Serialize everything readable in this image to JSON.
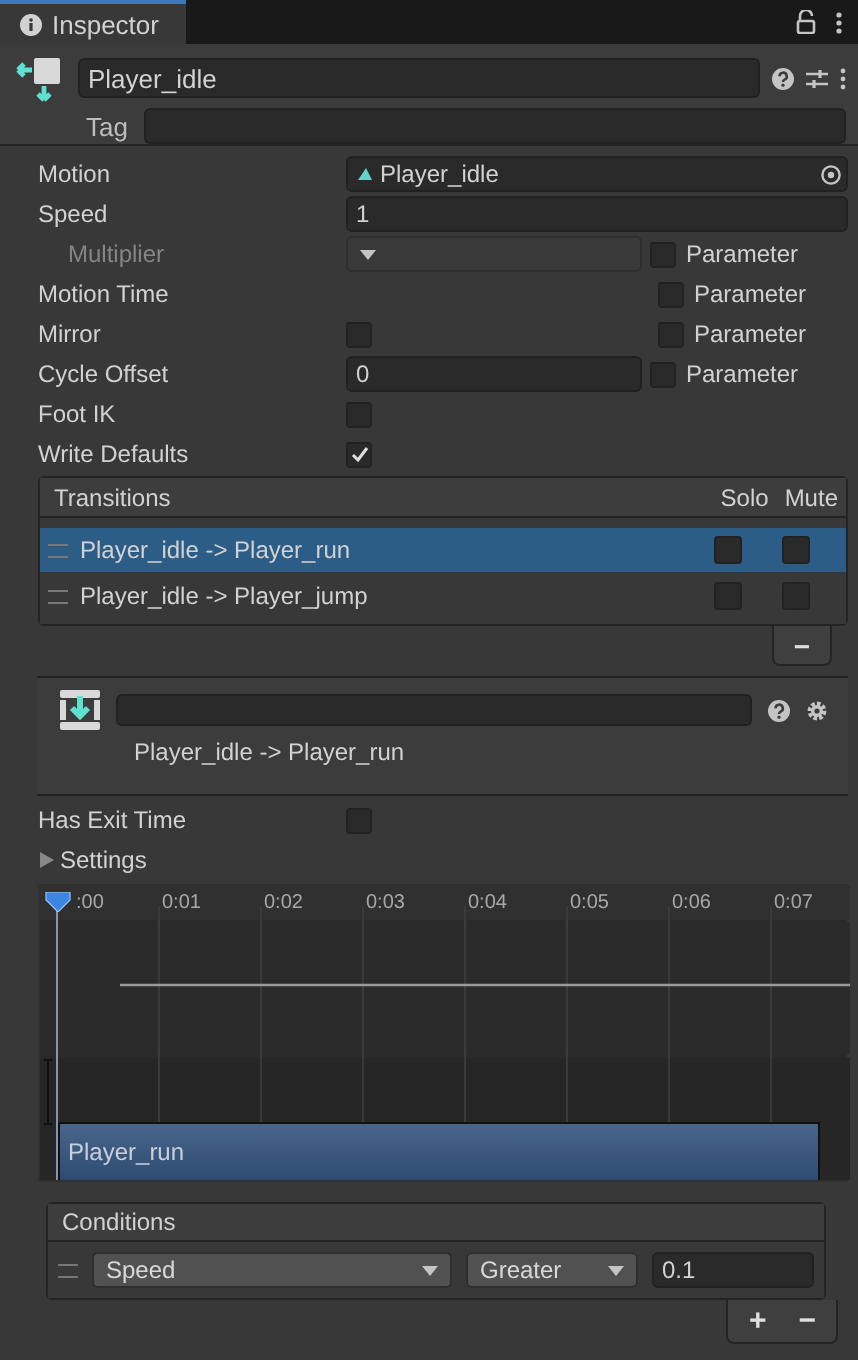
{
  "tab": {
    "label": "Inspector",
    "selected": true
  },
  "header": {
    "name": "Player_idle",
    "tag_label": "Tag"
  },
  "properties": [
    {
      "label": "Motion",
      "kind": "object",
      "value": "Player_idle"
    },
    {
      "label": "Speed",
      "kind": "number",
      "value": "1"
    },
    {
      "label": "Multiplier",
      "kind": "dropdown",
      "disabled": true,
      "indent": true,
      "parameter": {
        "label": "Parameter",
        "checked": false
      }
    },
    {
      "label": "Motion Time",
      "kind": "none",
      "parameter": {
        "label": "Parameter",
        "checked": false
      }
    },
    {
      "label": "Mirror",
      "kind": "checkbox",
      "checked": false,
      "parameter": {
        "label": "Parameter",
        "checked": false
      }
    },
    {
      "label": "Cycle Offset",
      "kind": "number",
      "value": "0",
      "narrow": true,
      "parameter": {
        "label": "Parameter",
        "checked": false
      }
    },
    {
      "label": "Foot IK",
      "kind": "checkbox",
      "checked": false
    },
    {
      "label": "Write Defaults",
      "kind": "checkbox",
      "checked": true
    }
  ],
  "transitions": {
    "title": "Transitions",
    "solo_label": "Solo",
    "mute_label": "Mute",
    "remove_label": "−",
    "rows": [
      {
        "name": "Player_idle -> Player_run",
        "selected": true,
        "solo": false,
        "mute": false
      },
      {
        "name": "Player_idle -> Player_jump",
        "selected": false,
        "solo": false,
        "mute": false
      }
    ]
  },
  "transition": {
    "title": "Player_idle -> Player_run",
    "has_exit_time_label": "Has Exit Time",
    "has_exit_time": false,
    "settings_label": "Settings",
    "settings_expanded": false
  },
  "timeline": {
    "ticks": [
      ":00",
      "0:01",
      "0:02",
      "0:03",
      "0:04",
      "0:05",
      "0:06",
      "0:07"
    ],
    "clip": "Player_run"
  },
  "conditions": {
    "title": "Conditions",
    "rows": [
      {
        "parameter": "Speed",
        "mode": "Greater",
        "value": "0.1"
      }
    ],
    "add_label": "+",
    "remove_label": "−"
  }
}
